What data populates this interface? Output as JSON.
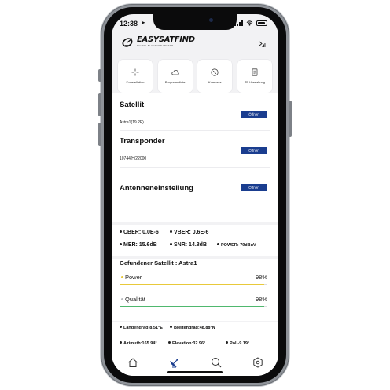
{
  "status": {
    "time": "12:38"
  },
  "brand": {
    "name": "SATFIND",
    "prefix": "EASY",
    "tagline": "DIGITAL BLUETOOTH METER"
  },
  "quick_actions": [
    {
      "label": "Konstellation",
      "icon": "crosshair-icon"
    },
    {
      "label": "Programmliste",
      "icon": "cloud-icon"
    },
    {
      "label": "Kompass",
      "icon": "compass-icon"
    },
    {
      "label": "TP Verwaltung",
      "icon": "document-icon"
    }
  ],
  "selection": {
    "satellite": {
      "title": "Satellit",
      "value": "Astra1(19.2E)",
      "button": "Öffnen"
    },
    "transponder": {
      "title": "Transponder",
      "value": "10744/H/22000",
      "button": "Öffnen"
    },
    "antenna": {
      "title": "Antenneneinstellung",
      "button": "Öffnen"
    }
  },
  "measurements": {
    "cber": "CBER: 0.0E-6",
    "vber": "VBER: 0.6E-6",
    "mer": "MER: 15.6dB",
    "snr": "SNR: 14.8dB",
    "power": "POWER: 79dBuV"
  },
  "found": {
    "title": "Gefundener Satellit : Astra1",
    "power": {
      "label": "Power",
      "percent_text": "98%",
      "level": 0.98,
      "color": "#e8c93a"
    },
    "quality": {
      "label": "Qualität",
      "percent_text": "98%",
      "level": 0.98,
      "color": "#4fb86e"
    }
  },
  "position": {
    "longitude": "Längengrad:8.51°E",
    "latitude": "Breitengrad:48.88°N",
    "azimuth": "Azimuth:165.94°",
    "elevation": "Elevation:32.96°",
    "pol": "Pol:-9.19°"
  },
  "tabs": [
    {
      "icon": "home-icon"
    },
    {
      "icon": "satellite-dish-icon",
      "active": true
    },
    {
      "icon": "search-icon"
    },
    {
      "icon": "settings-icon"
    }
  ],
  "colors": {
    "accent": "#1a3d8f",
    "active_tab": "#1a3d8f"
  }
}
